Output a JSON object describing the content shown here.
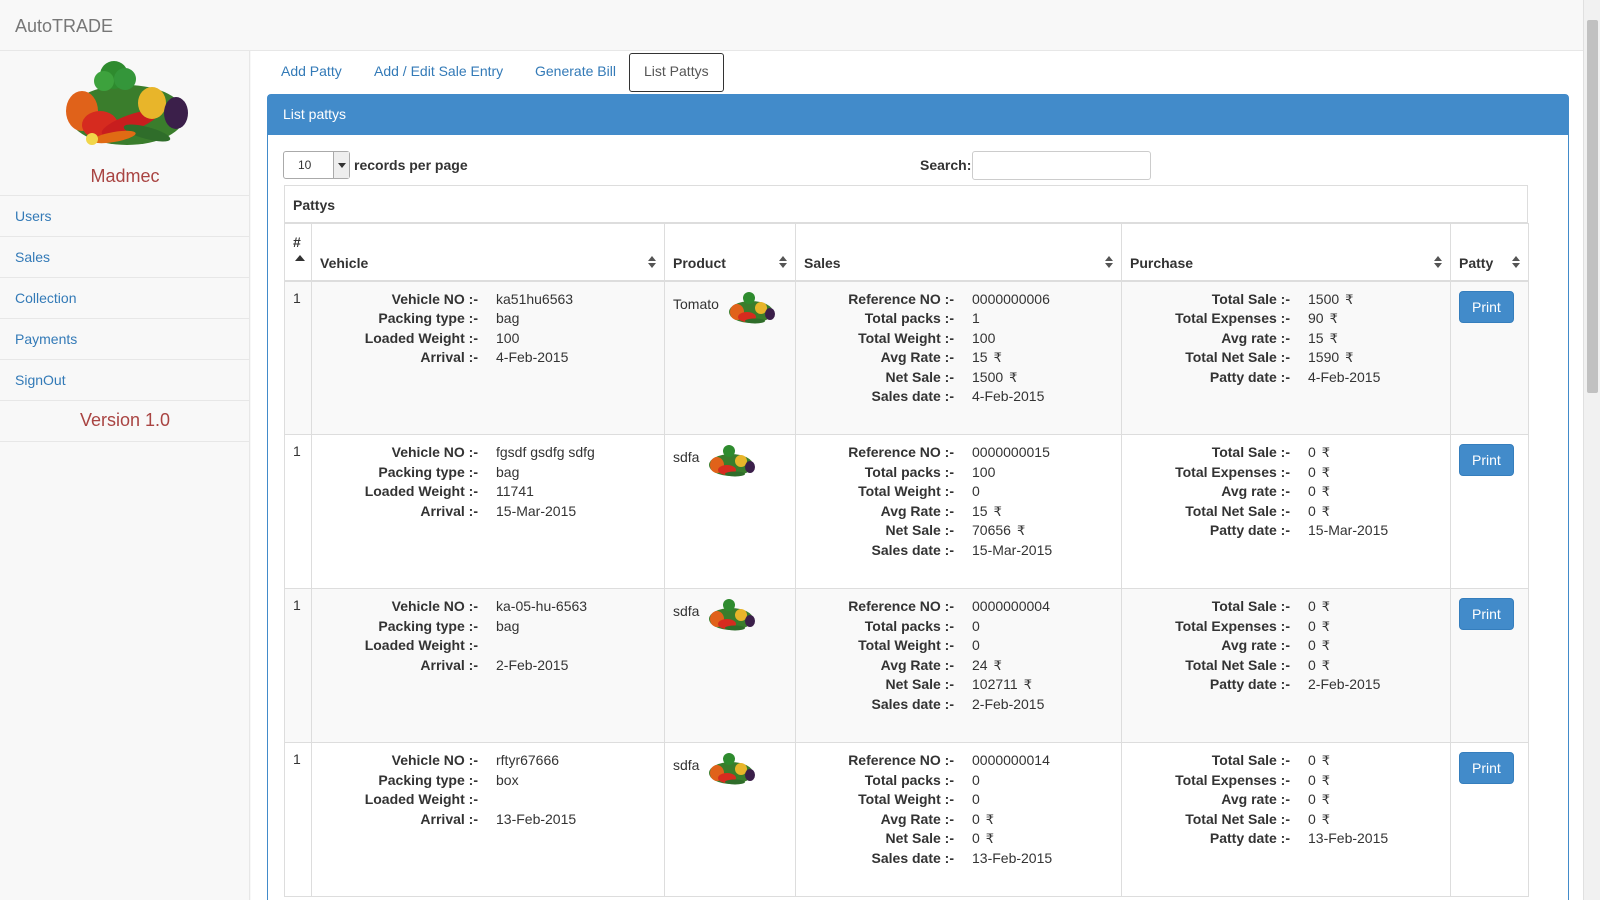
{
  "app": {
    "brand": "AutoTRADE"
  },
  "sidebar": {
    "company": "Madmec",
    "items": [
      {
        "label": "Users"
      },
      {
        "label": "Sales"
      },
      {
        "label": "Collection"
      },
      {
        "label": "Payments"
      },
      {
        "label": "SignOut"
      }
    ],
    "version": "Version 1.0"
  },
  "tabs": [
    {
      "label": "Add Patty"
    },
    {
      "label": "Add / Edit Sale Entry"
    },
    {
      "label": "Generate Bill"
    },
    {
      "label": "List Pattys",
      "active": true
    }
  ],
  "panel": {
    "title": "List pattys",
    "page_length": "10",
    "page_length_label": "records per page",
    "search_label": "Search:",
    "search_value": "",
    "table_caption": "Pattys"
  },
  "columns": [
    "#",
    "Vehicle",
    "Product",
    "Sales",
    "Purchase",
    "Patty"
  ],
  "labels": {
    "vehicle": [
      "Vehicle NO :-",
      "Packing type :-",
      "Loaded Weight :-",
      "Arrival :-"
    ],
    "sales": [
      "Reference NO :-",
      "Total packs :-",
      "Total Weight :-",
      "Avg Rate :-",
      "Net Sale :-",
      "Sales date :-"
    ],
    "purchase": [
      "Total Sale :-",
      "Total Expenses :-",
      "Avg rate :-",
      "Total Net Sale :-",
      "Patty date :-"
    ],
    "print": "Print",
    "rupee": "₹"
  },
  "rows": [
    {
      "num": "1",
      "vehicle": [
        "ka51hu6563",
        "bag",
        "100",
        "4-Feb-2015"
      ],
      "product": "Tomato",
      "sales": [
        "0000000006",
        "1",
        "100",
        "15",
        "1500",
        "4-Feb-2015"
      ],
      "purchase": [
        "1500",
        "90",
        "15",
        "1590",
        "4-Feb-2015"
      ]
    },
    {
      "num": "1",
      "vehicle": [
        "fgsdf gsdfg sdfg",
        "bag",
        "11741",
        "15-Mar-2015"
      ],
      "product": "sdfa",
      "sales": [
        "0000000015",
        "100",
        "0",
        "15",
        "70656",
        "15-Mar-2015"
      ],
      "purchase": [
        "0",
        "0",
        "0",
        "0",
        "15-Mar-2015"
      ]
    },
    {
      "num": "1",
      "vehicle": [
        "ka-05-hu-6563",
        "bag",
        "",
        "2-Feb-2015"
      ],
      "product": "sdfa",
      "sales": [
        "0000000004",
        "0",
        "0",
        "24",
        "102711",
        "2-Feb-2015"
      ],
      "purchase": [
        "0",
        "0",
        "0",
        "0",
        "2-Feb-2015"
      ]
    },
    {
      "num": "1",
      "vehicle": [
        "rftyr67666",
        "box",
        "",
        "13-Feb-2015"
      ],
      "product": "sdfa",
      "sales": [
        "0000000014",
        "0",
        "0",
        "0",
        "0",
        "13-Feb-2015"
      ],
      "purchase": [
        "0",
        "0",
        "0",
        "0",
        "13-Feb-2015"
      ]
    }
  ],
  "colors": {
    "primary": "#428bca",
    "link": "#337ab7",
    "brand_red": "#a94442"
  }
}
